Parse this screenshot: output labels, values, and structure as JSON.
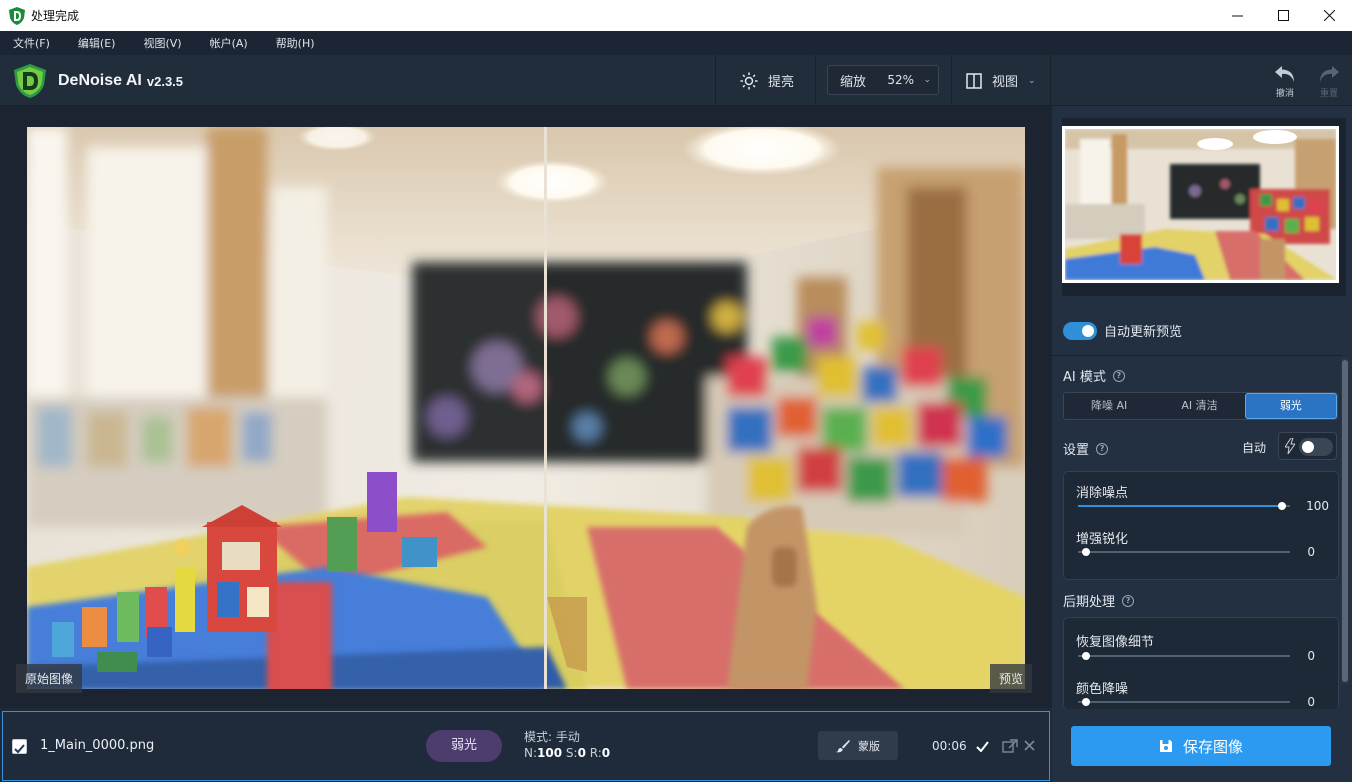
{
  "window": {
    "title": "处理完成"
  },
  "menu": [
    "文件(F)",
    "编辑(E)",
    "视图(V)",
    "帐户(A)",
    "帮助(H)"
  ],
  "app": {
    "name": "DeNoise AI",
    "version": "v2.3.5"
  },
  "toolbar": {
    "brighten": "提亮",
    "zoom_label": "缩放",
    "zoom_value": "52%",
    "view": "视图",
    "undo": "撤消",
    "redo": "重置"
  },
  "canvas": {
    "original_tag": "原始图像",
    "preview_tag": "预览"
  },
  "panel": {
    "auto_update": "自动更新预览",
    "ai_mode_title": "AI 模式",
    "modes": [
      "降噪 AI",
      "AI 清洁",
      "弱光"
    ],
    "active_mode": "弱光",
    "settings_title": "设置",
    "auto_label": "自动",
    "auto_enabled": false,
    "auto_update_enabled": true,
    "sliders": [
      {
        "label": "消除噪点",
        "value": 100,
        "max": 100
      },
      {
        "label": "增强锐化",
        "value": 0,
        "max": 100
      }
    ],
    "post_title": "后期处理",
    "post_sliders": [
      {
        "label": "恢复图像细节",
        "value": 0,
        "max": 100
      },
      {
        "label": "颜色降噪",
        "value": 0,
        "max": 100
      }
    ]
  },
  "file": {
    "name": "1_Main_0000.png",
    "checked": true,
    "mode_pill": "弱光",
    "mode_info": "模式: 手动",
    "n_label": "N:",
    "n_value": "100",
    "s_label": "S:",
    "s_value": "0",
    "r_label": "R:",
    "r_value": "0",
    "mask_label": "蒙版",
    "time": "00:06"
  },
  "save_button": "保存图像",
  "colors": {
    "accent": "#2b9af0",
    "active_mode": "#2b74c4",
    "pill": "#4d3d6e"
  }
}
